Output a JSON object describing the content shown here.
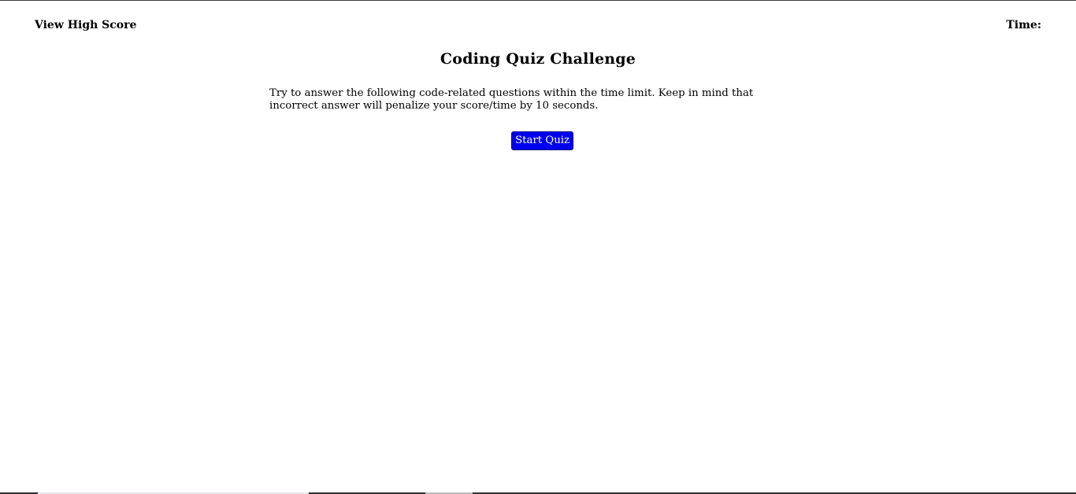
{
  "nav": {
    "high_score_label": "View High Score",
    "timer_label": "Time:"
  },
  "main": {
    "title": "Coding Quiz Challenge",
    "intro": "Try to answer the following code-related questions within the time limit. Keep in mind that incorrect answer will penalize your score/time by 10 seconds.",
    "start_button_label": "Start Quiz"
  },
  "colors": {
    "button_background": "#0000ee",
    "button_text": "#ffffff",
    "page_background": "#ffffff",
    "text": "#000000"
  }
}
